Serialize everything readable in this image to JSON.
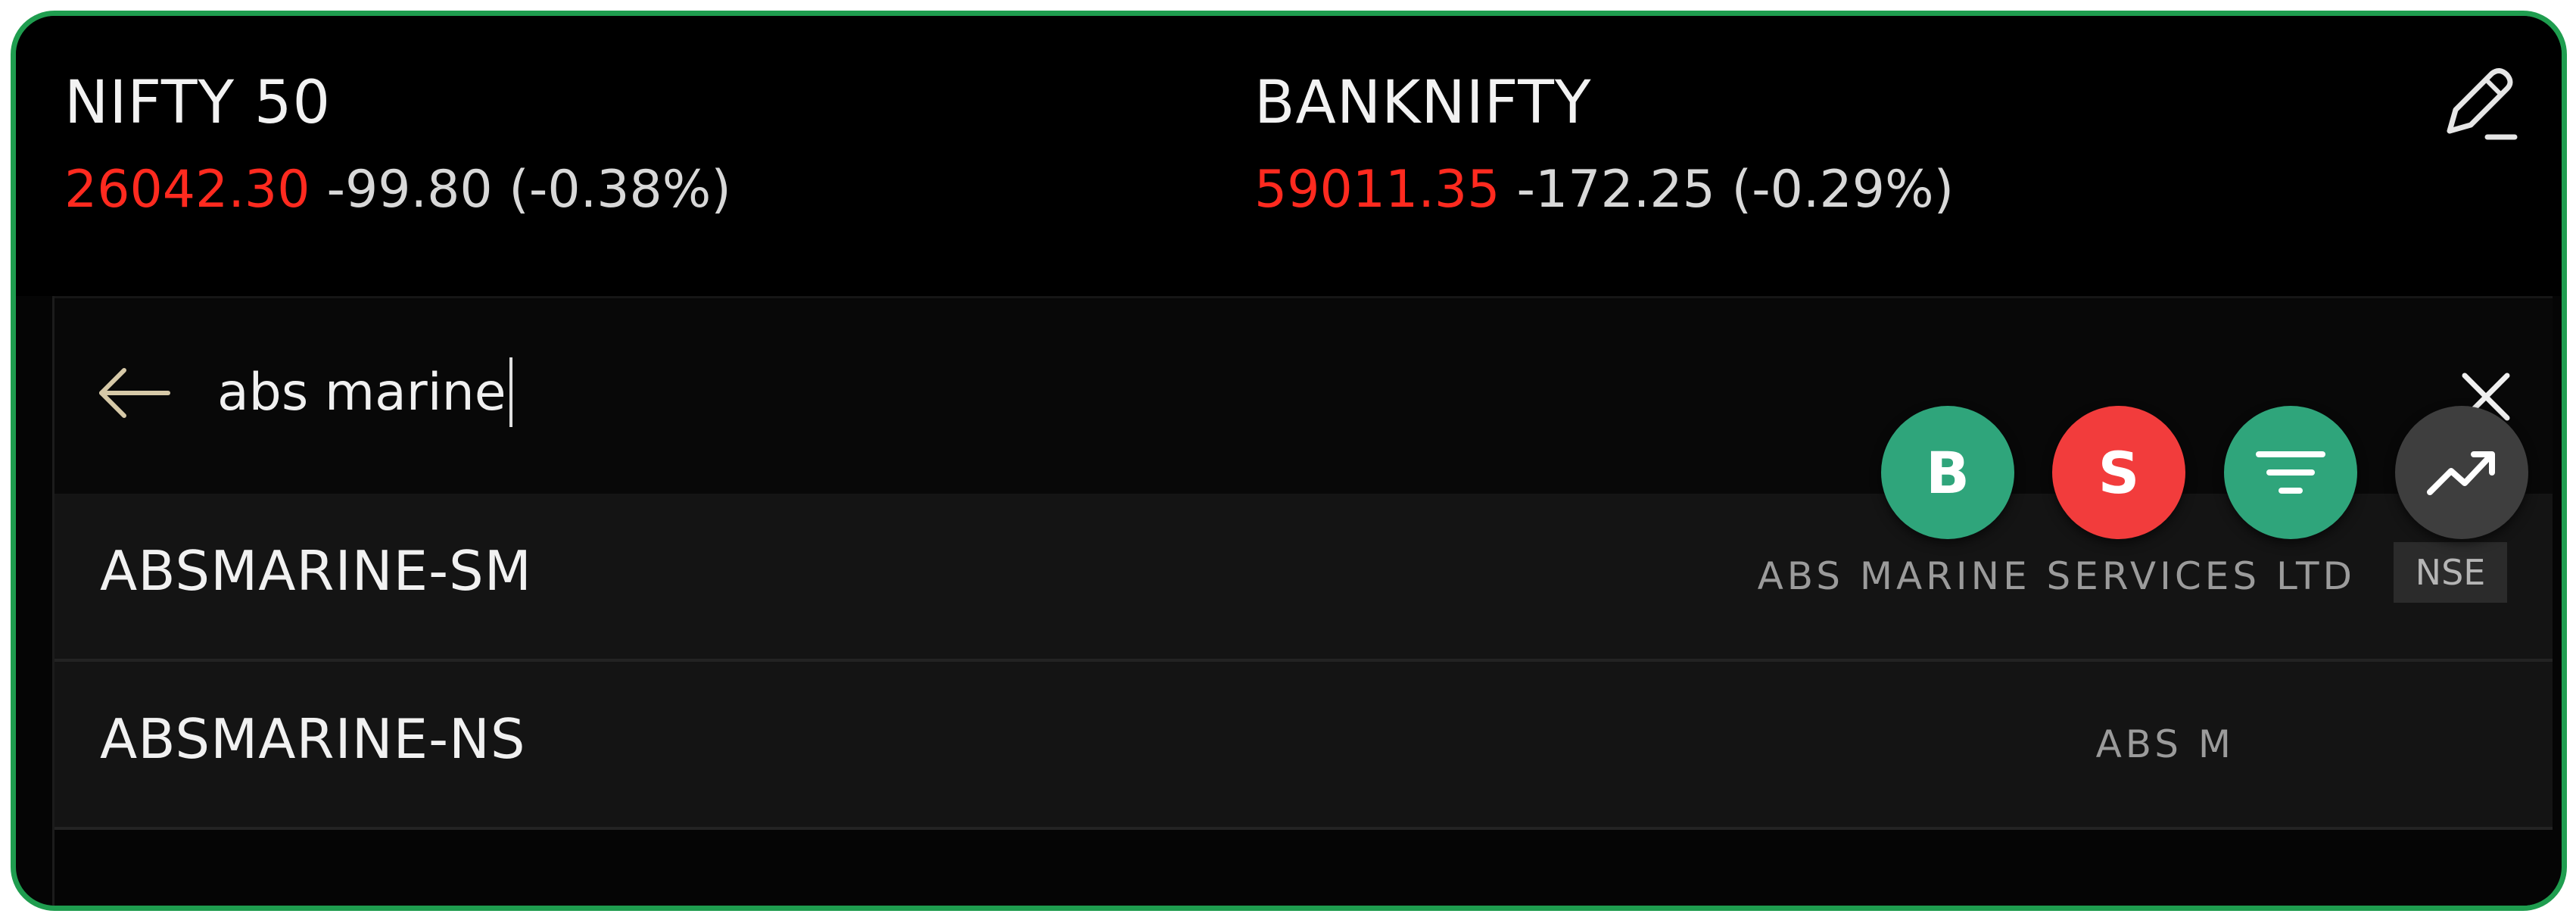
{
  "indices": [
    {
      "name": "NIFTY 50",
      "price": "26042.30",
      "change": "-99.80 (-0.38%)"
    },
    {
      "name": "BANKNIFTY",
      "price": "59011.35",
      "change": "-172.25 (-0.29%)"
    }
  ],
  "search": {
    "query": "abs marine"
  },
  "results": [
    {
      "symbol": "ABSMARINE-SM",
      "company": "ABS MARINE SERVICES LTD",
      "exchange": "NSE"
    },
    {
      "symbol": "ABSMARINE-NS",
      "company": "ABS M"
    }
  ],
  "actions": {
    "buy_label": "B",
    "sell_label": "S"
  },
  "colors": {
    "negative": "#ff2a1f",
    "buy": "#2fa57b",
    "sell": "#f23c3c",
    "border": "#1f9d4f"
  },
  "icons": [
    "edit-icon",
    "back-arrow-icon",
    "close-icon",
    "filter-icon",
    "trend-chart-icon"
  ]
}
